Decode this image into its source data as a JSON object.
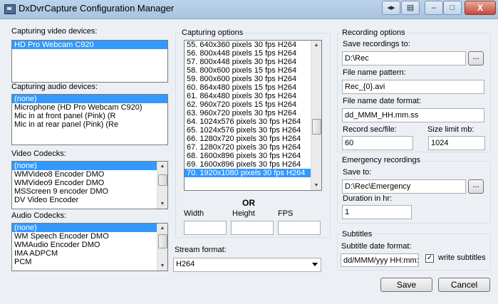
{
  "window": {
    "title": "DxDvrCapture Configuration Manager",
    "close_glyph": "X"
  },
  "left": {
    "video_devices_label": "Capturing video devices:",
    "video_devices": [
      "HD Pro Webcam C920"
    ],
    "audio_devices_label": "Capturing audio devices:",
    "audio_devices": [
      "(none)",
      "Microphone (HD Pro Webcam C920)",
      "Mic in at front panel (Pink) (R",
      "Mic in at rear panel (Pink) (Re"
    ],
    "video_codecs_label": "Video Codecks:",
    "video_codecs": [
      "(none)",
      "WMVideo8 Encoder DMO",
      "WMVideo9 Encoder DMO",
      "MSScreen 9 encoder DMO",
      "DV Video Encoder"
    ],
    "audio_codecs_label": "Audio Codecks:",
    "audio_codecs": [
      "(none)",
      "WM Speech Encoder DMO",
      "WMAudio Encoder DMO",
      "IMA ADPCM",
      "PCM"
    ]
  },
  "capture": {
    "label": "Capturing options",
    "options": [
      "55. 640x360 pixels 30 fps H264",
      "56. 800x448 pixels 15 fps H264",
      "57. 800x448 pixels 30 fps H264",
      "58. 800x600 pixels 15 fps H264",
      "59. 800x600 pixels 30 fps H264",
      "60. 864x480 pixels 15 fps H264",
      "61. 864x480 pixels 30 fps H264",
      "62. 960x720 pixels 15 fps H264",
      "63. 960x720 pixels 30 fps H264",
      "64. 1024x576 pixels 30 fps H264",
      "65. 1024x576 pixels 30 fps H264",
      "66. 1280x720 pixels 30 fps H264",
      "67. 1280x720 pixels 30 fps H264",
      "68. 1600x896 pixels 30 fps H264",
      "69. 1600x896 pixels 30 fps H264",
      "70. 1920x1080 pixels 30 fps H264"
    ],
    "selected_index": 15,
    "or_label": "OR",
    "width_label": "Width",
    "height_label": "Height",
    "fps_label": "FPS",
    "width_value": "",
    "height_value": "",
    "fps_value": "",
    "stream_format_label": "Stream format:",
    "stream_format_value": "H264"
  },
  "recording": {
    "label": "Recording options",
    "save_to_label": "Save recordings to:",
    "save_to_value": "D:\\Rec",
    "browse_label": "...",
    "pattern_label": "File name pattern:",
    "pattern_value": "Rec_{0}.avi",
    "date_format_label": "File name date format:",
    "date_format_value": "dd_MMM_HH.mm.ss",
    "record_sec_label": "Record sec/file:",
    "record_sec_value": "60",
    "size_limit_label": "Size limit mb:",
    "size_limit_value": "1024"
  },
  "emergency": {
    "label": "Emergency recordings",
    "save_to_label": "Save to:",
    "save_to_value": "D:\\Rec\\Emergency",
    "browse_label": "...",
    "duration_label": "Duration in hr:",
    "duration_value": "1"
  },
  "subtitles": {
    "label": "Subtitles",
    "date_format_label": "Subtitle date format:",
    "date_format_value": "dd/MMM/yyy HH:mm:",
    "write_label": "write subtitles",
    "write_checked": true,
    "check_glyph": "✓"
  },
  "buttons": {
    "save": "Save",
    "cancel": "Cancel"
  }
}
